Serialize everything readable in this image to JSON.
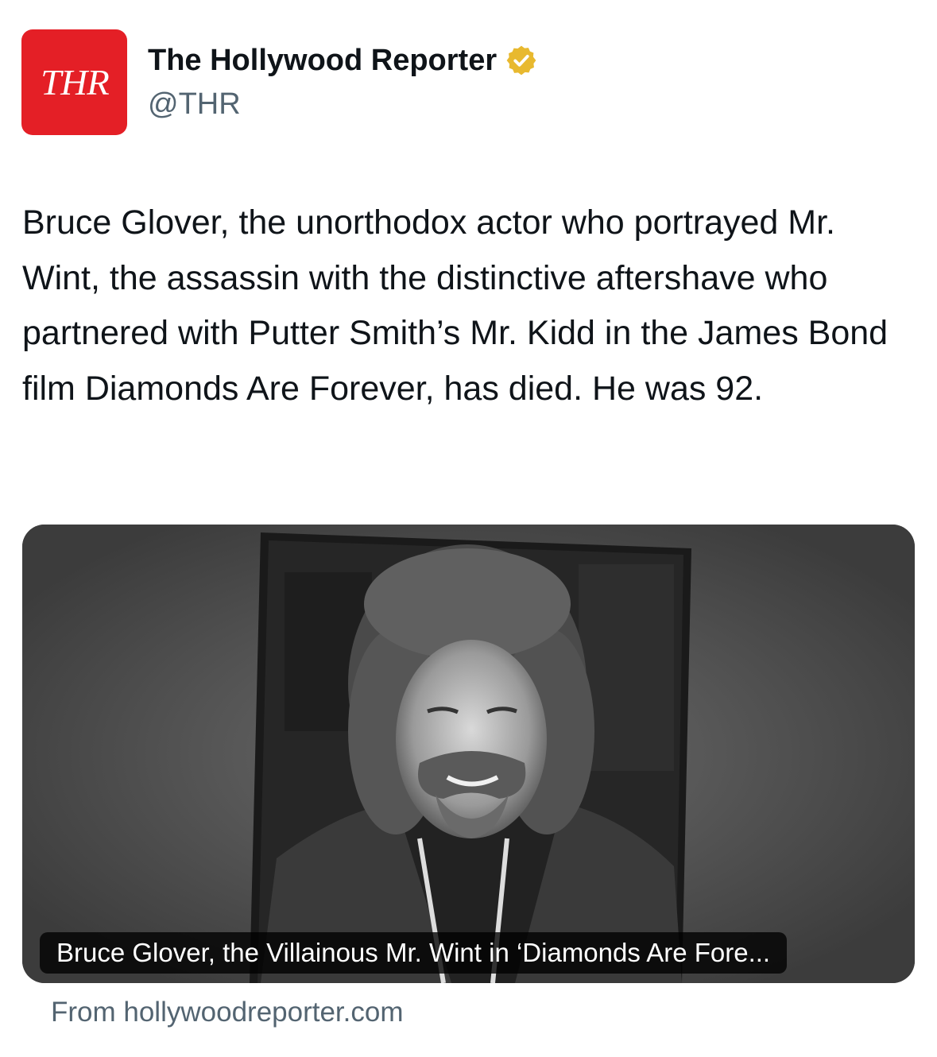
{
  "author": {
    "avatar_text": "THR",
    "avatar_color": "#e41f26",
    "display_name": "The Hollywood Reporter",
    "handle": "@THR",
    "verified_badge": "gold-verified-check-icon",
    "verified_color": "#e8b92f"
  },
  "tweet": {
    "text": "Bruce Glover, the unorthodox actor who portrayed Mr. Wint, the assassin with the distinctive aftershave who partnered with Putter Smith’s Mr. Kidd in the James Bond film Diamonds Are Forever, has died. He was 92."
  },
  "link_card": {
    "caption": "Bruce Glover, the Villainous Mr. Wint in ‘Diamonds Are Fore...",
    "source_label": "From hollywoodreporter.com"
  }
}
